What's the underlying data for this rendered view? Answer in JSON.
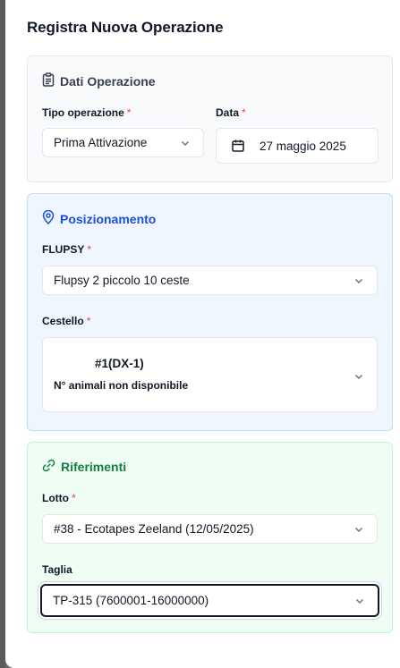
{
  "dialog": {
    "title": "Registra Nuova Operazione"
  },
  "dati": {
    "header": "Dati Operazione",
    "tipo_label": "Tipo operazione",
    "tipo_value": "Prima Attivazione",
    "data_label": "Data",
    "data_value": "27 maggio 2025",
    "required_mark": "*"
  },
  "posizionamento": {
    "header": "Posizionamento",
    "flupsy_label": "FLUPSY",
    "flupsy_value": "Flupsy 2 piccolo 10 ceste",
    "cestello_label": "Cestello",
    "cestello_name": "#1(DX-1)",
    "cestello_sub": "N° animali non disponibile",
    "required_mark": "*"
  },
  "riferimenti": {
    "header": "Riferimenti",
    "lotto_label": "Lotto",
    "lotto_value": "#38 - Ecotapes Zeeland (12/05/2025)",
    "taglia_label": "Taglia",
    "taglia_value": "TP-315 (7600001-16000000)",
    "required_mark": "*"
  },
  "colors": {
    "posizionamento_accent": "#1d4ed8",
    "riferimenti_accent": "#15803d",
    "required": "#ef4444"
  },
  "icons": [
    "clipboard-icon",
    "calendar-icon",
    "map-pin-icon",
    "link-icon",
    "chevron-down-icon"
  ]
}
